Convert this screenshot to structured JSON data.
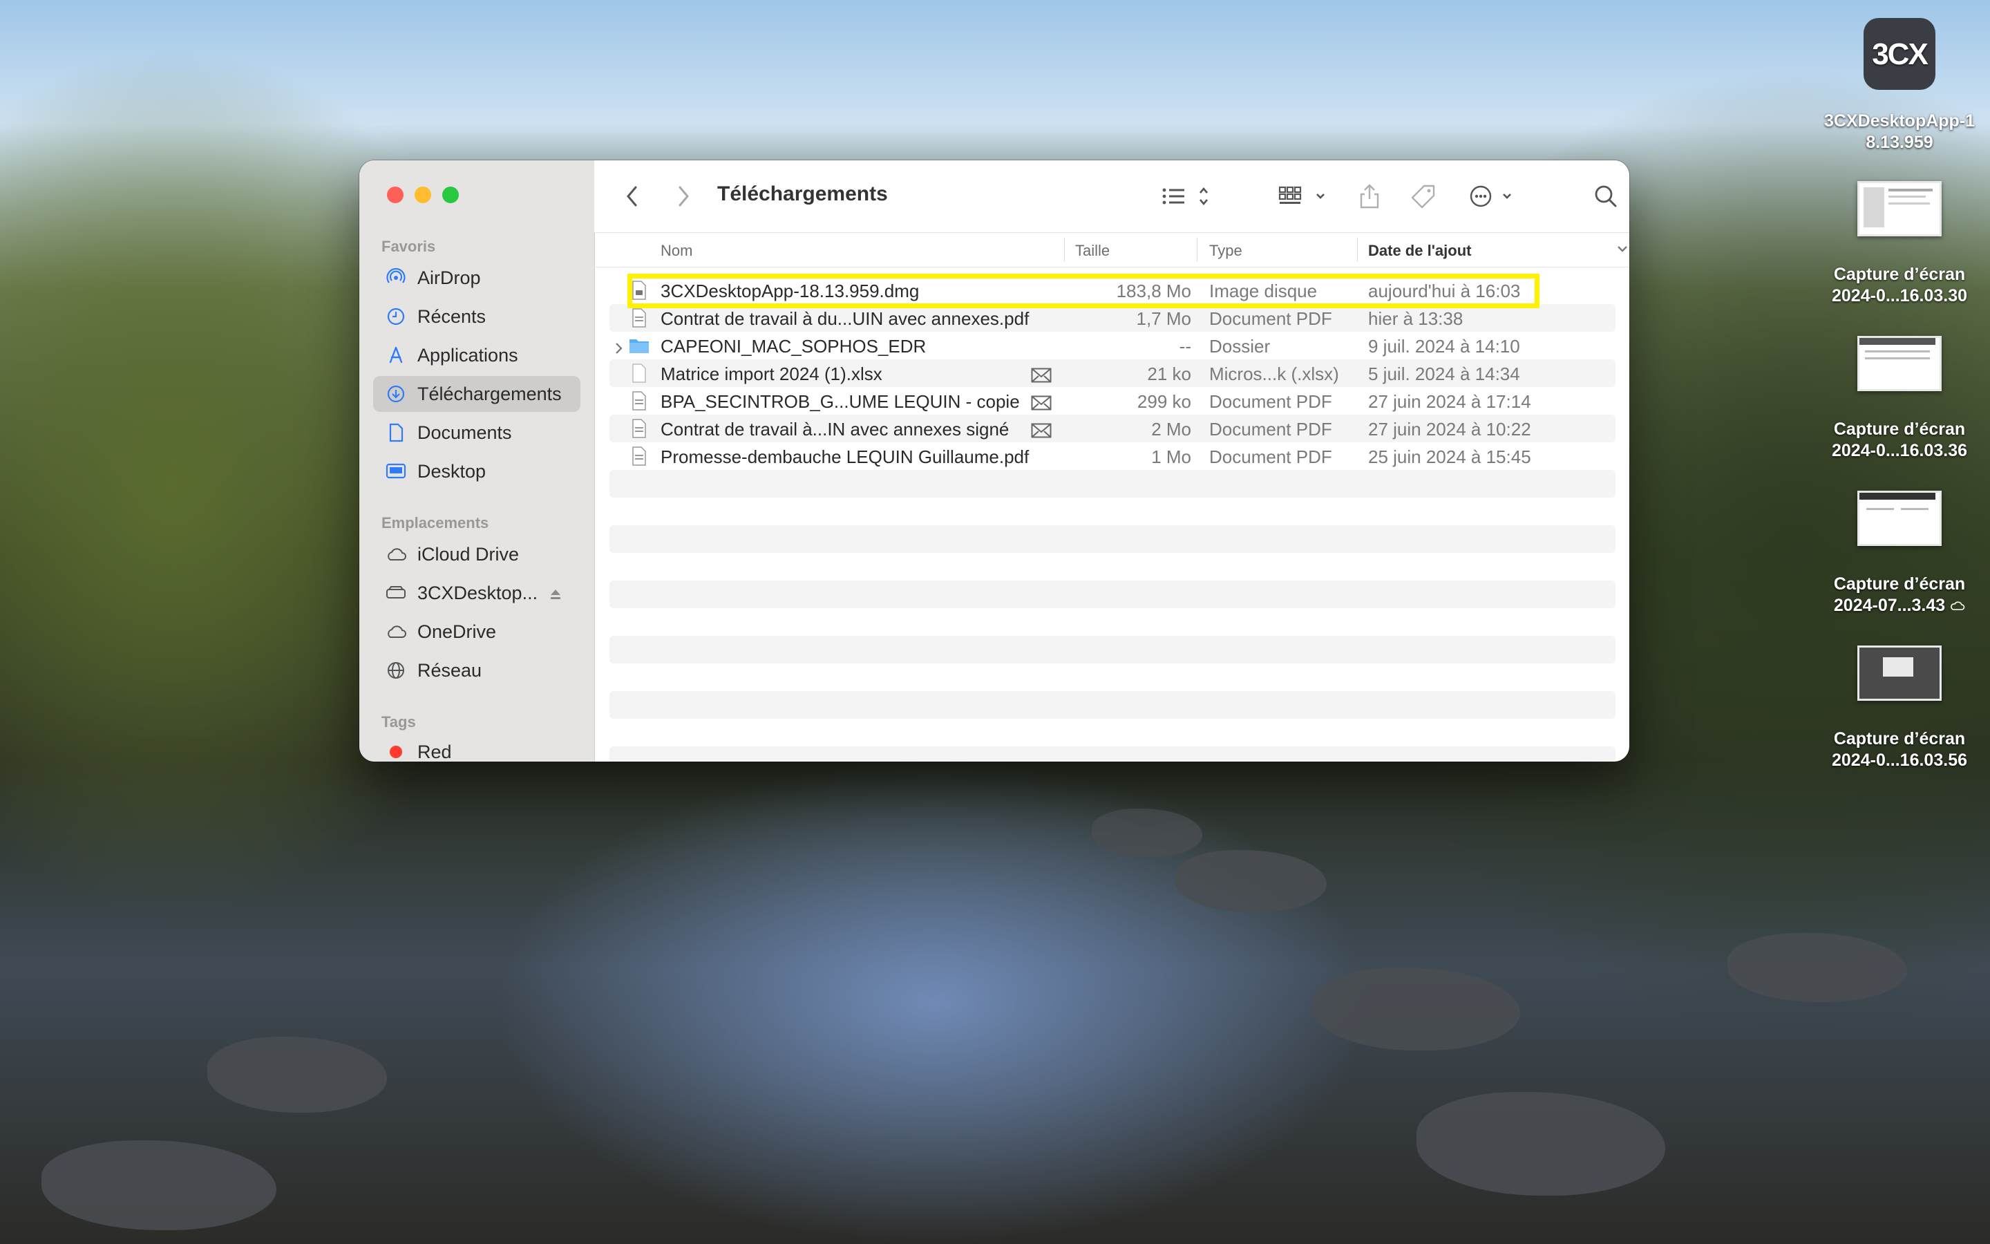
{
  "finder": {
    "title": "Téléchargements",
    "sidebar": {
      "sections": [
        {
          "label": "Favoris",
          "items": [
            {
              "label": "AirDrop",
              "icon": "airdrop-icon"
            },
            {
              "label": "Récents",
              "icon": "clock-icon"
            },
            {
              "label": "Applications",
              "icon": "applications-icon"
            },
            {
              "label": "Téléchargements",
              "icon": "download-icon",
              "selected": true
            },
            {
              "label": "Documents",
              "icon": "document-icon"
            },
            {
              "label": "Desktop",
              "icon": "desktop-icon"
            }
          ]
        },
        {
          "label": "Emplacements",
          "items": [
            {
              "label": "iCloud Drive",
              "icon": "cloud-icon"
            },
            {
              "label": "3CXDesktop...",
              "icon": "disk-icon",
              "eject": true
            },
            {
              "label": "OneDrive",
              "icon": "cloud-icon"
            },
            {
              "label": "Réseau",
              "icon": "network-icon"
            }
          ]
        },
        {
          "label": "Tags",
          "items": [
            {
              "label": "Red",
              "icon": "red-tag-icon",
              "color": "#ff3b30"
            }
          ]
        }
      ]
    },
    "columns": {
      "name": "Nom",
      "size": "Taille",
      "type": "Type",
      "date": "Date de l'ajout"
    },
    "files": [
      {
        "name": "3CXDesktopApp-18.13.959.dmg",
        "size": "183,8 Mo",
        "type": "Image disque",
        "date": "aujourd'hui à 16:03",
        "icon": "dmg-file-icon",
        "highlighted": true
      },
      {
        "name": "Contrat de travail à du...UIN avec annexes.pdf",
        "size": "1,7 Mo",
        "type": "Document PDF",
        "date": "hier à 13:38",
        "icon": "pdf-file-icon"
      },
      {
        "name": "CAPEONI_MAC_SOPHOS_EDR",
        "size": "--",
        "type": "Dossier",
        "date": "9 juil. 2024 à 14:10",
        "icon": "folder-icon",
        "folder": true
      },
      {
        "name": "Matrice import 2024 (1).xlsx",
        "size": "21 ko",
        "type": "Micros...k (.xlsx)",
        "date": "5 juil. 2024 à 14:34",
        "icon": "xlsx-file-icon",
        "mail": true
      },
      {
        "name": "BPA_SECINTROB_G...UME LEQUIN - copie",
        "size": "299 ko",
        "type": "Document PDF",
        "date": "27 juin 2024 à 17:14",
        "icon": "pdf-file-icon",
        "mail": true
      },
      {
        "name": "Contrat de travail à...IN avec annexes signé",
        "size": "2 Mo",
        "type": "Document PDF",
        "date": "27 juin 2024 à 10:22",
        "icon": "pdf-file-icon",
        "mail": true
      },
      {
        "name": "Promesse-dembauche LEQUIN Guillaume.pdf",
        "size": "1 Mo",
        "type": "Document PDF",
        "date": "25 juin 2024 à 15:45",
        "icon": "pdf-file-icon"
      }
    ],
    "highlight_color": "#fff200"
  },
  "desktop": {
    "icons": [
      {
        "label1": "3CXDesktopApp-1",
        "label2": "8.13.959",
        "kind": "app",
        "glyph": "3CX"
      },
      {
        "label1": "Capture d’écran",
        "label2": "2024-0...16.03.30",
        "kind": "screenshot"
      },
      {
        "label1": "Capture d’écran",
        "label2": "2024-0...16.03.36",
        "kind": "screenshot"
      },
      {
        "label1": "Capture d’écran",
        "label2": "2024-07...3.43",
        "kind": "screenshot",
        "cloud": true
      },
      {
        "label1": "Capture d’écran",
        "label2": "2024-0...16.03.56",
        "kind": "screenshot"
      }
    ]
  }
}
